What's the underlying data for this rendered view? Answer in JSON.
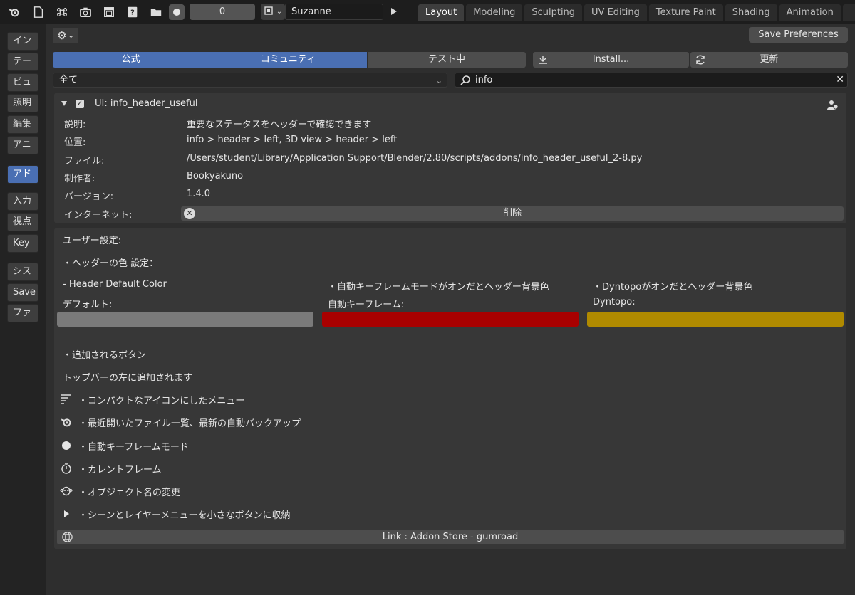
{
  "topbar": {
    "frame_value": "0",
    "object_name": "Suzanne",
    "workspace_tabs": [
      "Layout",
      "Modeling",
      "Sculpting",
      "UV Editing",
      "Texture Paint",
      "Shading",
      "Animation"
    ],
    "active_tab": "Layout"
  },
  "sidebar": {
    "items": [
      "イン",
      "テー",
      "ビュ",
      "照明",
      "編集",
      "アニ",
      "アド",
      "入力",
      "視点",
      "Key",
      "シス",
      "Save",
      "ファ"
    ],
    "active": "アド"
  },
  "header": {
    "save_label": "Save Preferences",
    "support_tabs": [
      "公式",
      "コミュニティ",
      "テスト中"
    ],
    "install_label": "Install...",
    "refresh_label": "更新",
    "category_filter": "全て",
    "search_value": "info"
  },
  "addon": {
    "title": "UI: info_header_useful",
    "rows": [
      {
        "label": "説明:",
        "value": "重要なステータスをヘッダーで確認できます"
      },
      {
        "label": "位置:",
        "value": "info > header > left, 3D view > header > left"
      },
      {
        "label": "ファイル:",
        "value": "/Users/student/Library/Application Support/Blender/2.80/scripts/addons/info_header_useful_2-8.py"
      },
      {
        "label": "制作者:",
        "value": "Bookyakuno"
      },
      {
        "label": "バージョン:",
        "value": "1.4.0"
      }
    ],
    "internet_label": "インターネット:",
    "remove_label": "削除"
  },
  "prefs": {
    "user_settings": "ユーザー設定:",
    "header_color_title": "・ヘッダーの色 設定：",
    "colors": [
      {
        "heading": "- Header Default Color",
        "label": "デフォルト:",
        "color": "#7a7a7a"
      },
      {
        "heading": "・自動キーフレームモードがオンだとヘッダー背景色",
        "label": "自動キーフレーム:",
        "color": "#a80000"
      },
      {
        "heading": "・Dyntopoがオンだとヘッダー背景色",
        "label": "Dyntopo:",
        "color": "#b08a00"
      }
    ],
    "buttons_title": "・追加されるボタン",
    "buttons_subtitle": "トップバーの左に追加されます",
    "features": [
      {
        "icon": "compact-menu-icon",
        "text": "・コンパクトなアイコンにしたメニュー"
      },
      {
        "icon": "blender-logo-icon",
        "text": "・最近開いたファイル一覧、最新の自動バックアップ"
      },
      {
        "icon": "record-dot-icon",
        "text": "・自動キーフレームモード"
      },
      {
        "icon": "stopwatch-icon",
        "text": "・カレントフレーム"
      },
      {
        "icon": "monkey-head-icon",
        "text": "・オブジェクト名の変更"
      },
      {
        "icon": "play-triangle-icon",
        "text": "・シーンとレイヤーメニューを小さなボタンに収納"
      }
    ],
    "link_label": "Link : Addon Store - gumroad"
  }
}
